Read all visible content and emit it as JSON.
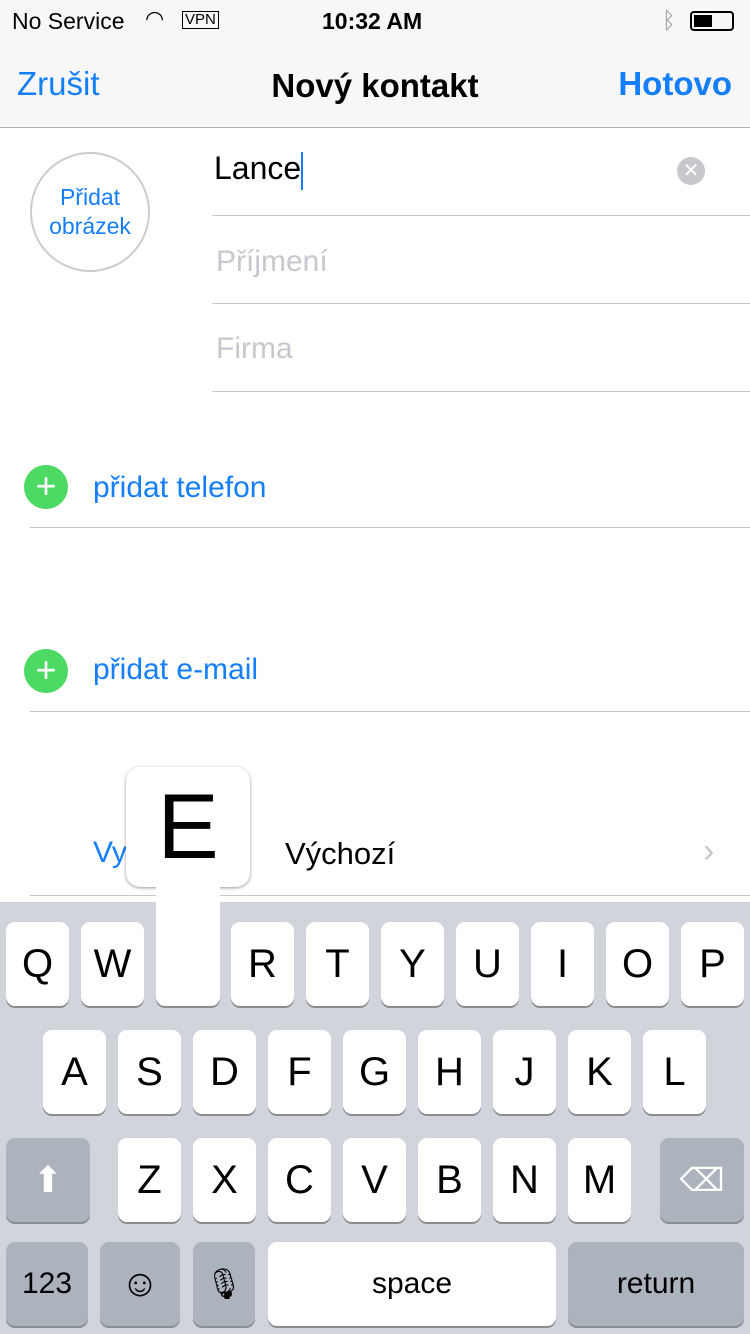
{
  "status": {
    "carrier": "No Service",
    "vpn": "VPN",
    "time": "10:32 AM"
  },
  "nav": {
    "cancel": "Zrušit",
    "title": "Nový kontakt",
    "done": "Hotovo"
  },
  "photo": {
    "label_line1": "Přidat",
    "label_line2": "obrázek"
  },
  "fields": {
    "first_name": "Lance",
    "last_name_placeholder": "Příjmení",
    "company_placeholder": "Firma"
  },
  "rows": {
    "add_phone": "přidat telefon",
    "add_email": "přidat e-mail",
    "ringtone_label": "Vy",
    "ringtone_value": "Výchozí"
  },
  "keyboard": {
    "row1": [
      "Q",
      "W",
      "E",
      "R",
      "T",
      "Y",
      "U",
      "I",
      "O",
      "P"
    ],
    "row2": [
      "A",
      "S",
      "D",
      "F",
      "G",
      "H",
      "J",
      "K",
      "L"
    ],
    "row3": [
      "Z",
      "X",
      "C",
      "V",
      "B",
      "N",
      "M"
    ],
    "numbers": "123",
    "space": "space",
    "return": "return",
    "popup": "E"
  },
  "colors": {
    "accent": "#157efb",
    "add": "#4cd964"
  }
}
